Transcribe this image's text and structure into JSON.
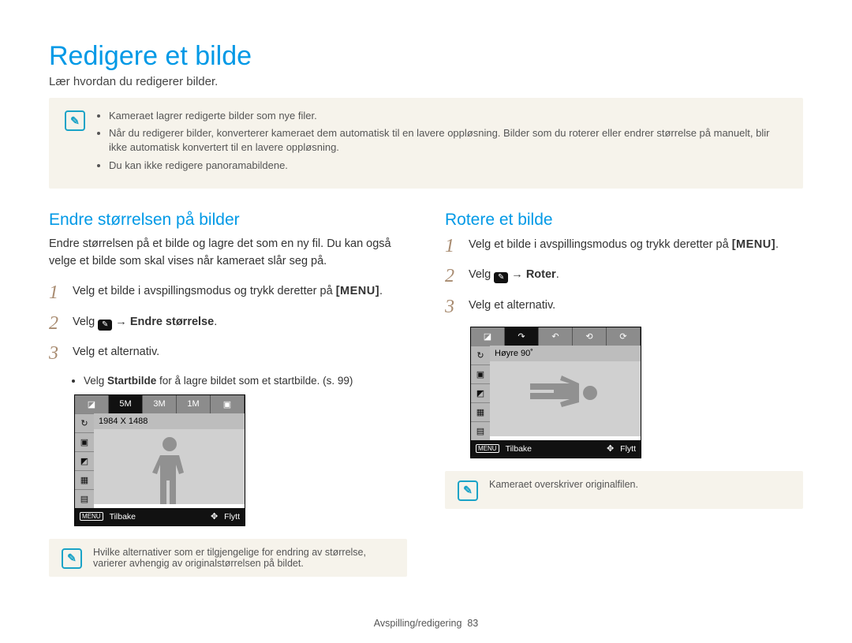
{
  "title": "Redigere et bilde",
  "subtitle": "Lær hvordan du redigerer bilder.",
  "top_notes": [
    "Kameraet lagrer redigerte bilder som nye filer.",
    "Når du redigerer bilder, konverterer kameraet dem automatisk til en lavere oppløsning. Bilder som du roterer eller endrer størrelse på manuelt, blir ikke automatisk konvertert til en lavere oppløsning.",
    "Du kan ikke redigere panoramabildene."
  ],
  "left": {
    "heading": "Endre størrelsen på bilder",
    "lead": "Endre størrelsen på et bilde og lagre det som en ny fil. Du kan også velge et bilde som skal vises når kameraet slår seg på.",
    "steps": {
      "s1": "Velg et bilde i avspillingsmodus og trykk deretter på ",
      "s1_key": "[MENU]",
      "s1_end": ".",
      "s2_a": "Velg ",
      "s2_b": " → ",
      "s2_c": "Endre størrelse",
      "s2_end": ".",
      "s3": "Velg et alternativ."
    },
    "sub_bullet_a": "Velg ",
    "sub_bullet_b": "Startbilde",
    "sub_bullet_c": " for å lagre bildet som et startbilde. (s. 99)",
    "screen": {
      "value": "1984 X 1488",
      "back_label": "Tilbake",
      "move_label": "Flytt",
      "menu_tag": "MENU"
    },
    "bottom_note": "Hvilke alternativer som er tilgjengelige for endring av størrelse, varierer avhengig av originalstørrelsen på bildet."
  },
  "right": {
    "heading": "Rotere et bilde",
    "steps": {
      "s1": "Velg et bilde i avspillingsmodus og trykk deretter på ",
      "s1_key": "[MENU]",
      "s1_end": ".",
      "s2_a": "Velg ",
      "s2_b": " → ",
      "s2_c": "Roter",
      "s2_end": ".",
      "s3": "Velg et alternativ."
    },
    "screen": {
      "value": "Høyre 90˚",
      "back_label": "Tilbake",
      "move_label": "Flytt",
      "menu_tag": "MENU"
    },
    "bottom_note": "Kameraet overskriver originalfilen."
  },
  "footer": {
    "section": "Avspilling/redigering",
    "page": "83"
  }
}
